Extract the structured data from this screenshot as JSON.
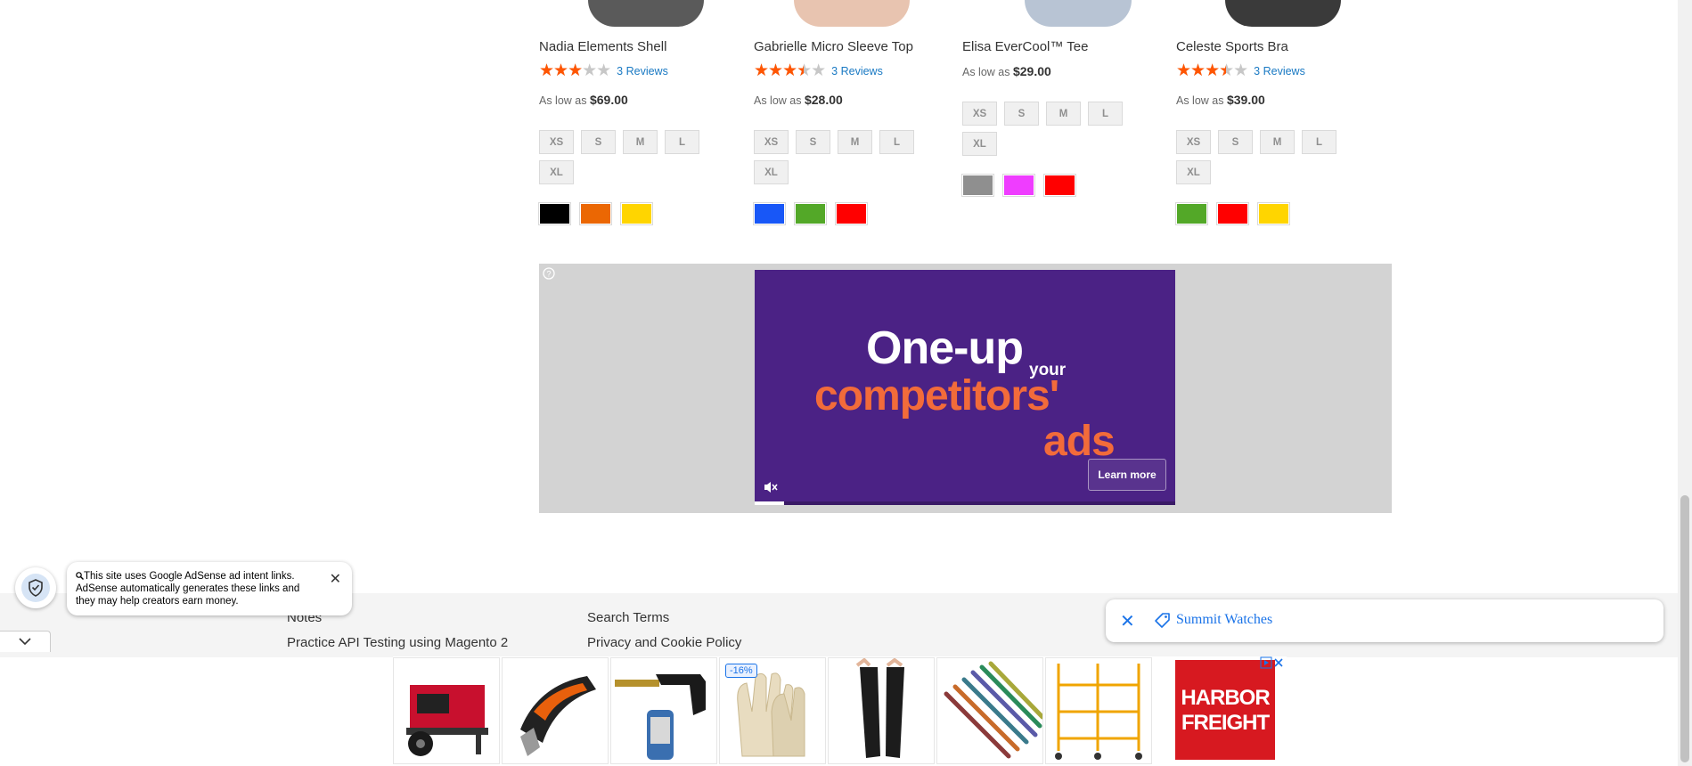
{
  "products": [
    {
      "name": "Nadia Elements Shell",
      "rating": 0.6,
      "reviews": "3 Reviews",
      "price_prefix": "As low as",
      "price": "$69.00",
      "sizes": [
        "XS",
        "S",
        "M",
        "L",
        "XL"
      ],
      "colors": [
        "#000000",
        "#eb6703",
        "#ffd500"
      ],
      "image_color": "#5a5a5a"
    },
    {
      "name": "Gabrielle Micro Sleeve Top",
      "rating": 0.7,
      "reviews": "3 Reviews",
      "price_prefix": "As low as",
      "price": "$28.00",
      "sizes": [
        "XS",
        "S",
        "M",
        "L",
        "XL"
      ],
      "colors": [
        "#1857f7",
        "#53a828",
        "#ff0000"
      ],
      "image_color": "#e8c4b0"
    },
    {
      "name": "Elisa EverCool™ Tee",
      "rating": null,
      "reviews": "",
      "price_prefix": "As low as",
      "price": "$29.00",
      "sizes": [
        "XS",
        "S",
        "M",
        "L",
        "XL"
      ],
      "colors": [
        "#8f8f8f",
        "#ef3dff",
        "#ff0000"
      ],
      "image_color": "#b8c4d4"
    },
    {
      "name": "Celeste Sports Bra",
      "rating": 0.7,
      "reviews": "3 Reviews",
      "price_prefix": "As low as",
      "price": "$39.00",
      "sizes": [
        "XS",
        "S",
        "M",
        "L",
        "XL"
      ],
      "colors": [
        "#53a828",
        "#ff0000",
        "#ffd500"
      ],
      "image_color": "#3a3a3a"
    }
  ],
  "ad_banner": {
    "line1": "One-up",
    "line1_small": "your",
    "line2": "competitors'",
    "line3": "ads",
    "cta": "Learn more",
    "progress": 0.07
  },
  "footer": {
    "col1": [
      "Notes",
      "Practice API Testing using Magento 2"
    ],
    "col2": [
      "Search Terms",
      "Privacy and Cookie Policy"
    ]
  },
  "adsense_notice": {
    "text": "This site uses Google AdSense ad intent links. AdSense automatically generates these links and they may help creators earn money."
  },
  "search_chip": {
    "label": "Summit Watches"
  },
  "ad_strip": {
    "discount_badge": "-16%",
    "brand_logo_text": "HARBOR FREIGHT",
    "tiles": [
      "generator",
      "electric-shears",
      "propane-torch",
      "leather-gloves",
      "arm-sleeves",
      "drill-bits",
      "scaffold"
    ]
  },
  "colors": {
    "star": "#ff5501",
    "link": "#1979c3",
    "ad_purple": "#4b2285",
    "ad_orange": "#f26b3a",
    "hf_red": "#d71920"
  }
}
